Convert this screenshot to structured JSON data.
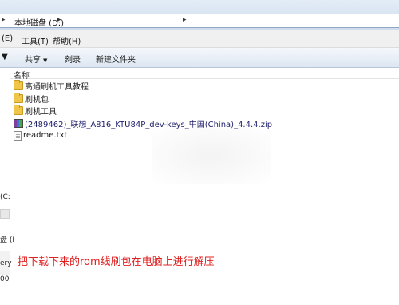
{
  "address_bar": {
    "lead_glyph": "▸",
    "path_text": "本地磁盘 (D:)",
    "separator": "▸",
    "dropdown": "▸"
  },
  "menu": {
    "items": [
      {
        "label": "(E)"
      },
      {
        "label": "工具(T)"
      },
      {
        "label": "帮助(H)"
      }
    ]
  },
  "toolbar": {
    "share_label": "共享",
    "share_dropdown": "▼",
    "burn_label": "刻录",
    "new_folder_label": "新建文件夹",
    "left_dropdown": "▼"
  },
  "columns": {
    "name_header": "名称"
  },
  "files": [
    {
      "name": "高通刷机工具教程",
      "type": "folder"
    },
    {
      "name": "刷机包",
      "type": "folder"
    },
    {
      "name": "刷机工具",
      "type": "folder"
    },
    {
      "name": "(2489462)_联想_A816_KTU84P_dev-keys_中国(China)_4.4.4.zip",
      "type": "zip"
    },
    {
      "name": "readme.txt",
      "type": "txt"
    }
  ],
  "nav_pane": {
    "fragments": [
      {
        "text": "(C:"
      },
      {
        "text": "盘 (I"
      },
      {
        "text": "ery"
      },
      {
        "text": "00"
      }
    ]
  },
  "caption": {
    "text": "把下载下来的rom线刷包在电脑上进行解压"
  },
  "colors": {
    "caption": "#e02020",
    "folder": "#f0c64a",
    "toolbar_bg": "#dde7f2"
  }
}
